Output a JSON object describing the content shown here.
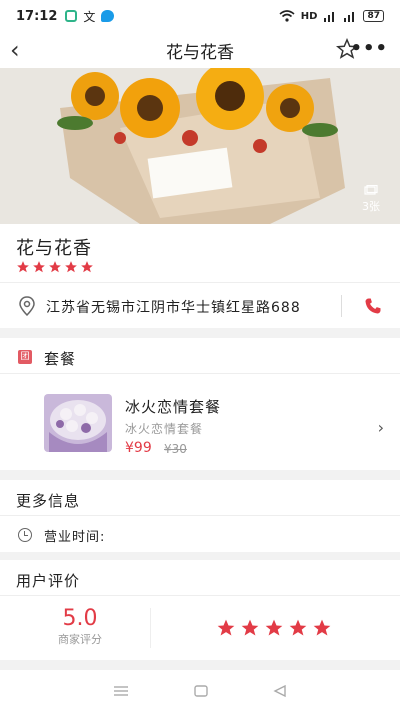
{
  "status_bar": {
    "time": "17:12",
    "network": "HD",
    "battery": "87"
  },
  "nav": {
    "title": "花与花香",
    "back_icon": "back-arrow-icon",
    "favorite_icon": "star-outline-icon",
    "more_icon": "more-dots-icon"
  },
  "hero": {
    "photo_count": "3张"
  },
  "shop": {
    "name": "花与花香",
    "rating_stars": 5,
    "address": "江苏省无锡市江阴市华士镇红星路688"
  },
  "package_section": {
    "header": "套餐",
    "badge": "团",
    "item": {
      "name": "冰火恋情套餐",
      "subtitle": "冰火恋情套餐",
      "price": "¥99",
      "original_price": "¥30"
    }
  },
  "more_info": {
    "header": "更多信息",
    "hours_label": "营业时间:"
  },
  "reviews": {
    "header": "用户评价",
    "score": "5.0",
    "score_label": "商家评分",
    "stars": 5
  },
  "colors": {
    "accent": "#e23b46"
  }
}
